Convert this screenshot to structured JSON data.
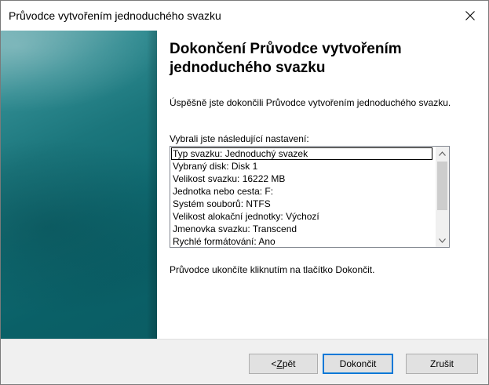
{
  "window": {
    "title": "Průvodce vytvořením jednoduchého svazku"
  },
  "content": {
    "heading": "Dokončení Průvodce vytvořením jednoduchého svazku",
    "success_text": "Úspěšně jste dokončili Průvodce vytvořením jednoduchého svazku.",
    "chosen_label": "Vybrali jste následující nastavení:",
    "settings": [
      "Typ svazku: Jednoduchý svazek",
      "Vybraný disk: Disk 1",
      "Velikost svazku: 16222 MB",
      "Jednotka nebo cesta: F:",
      "Systém souborů: NTFS",
      "Velikost alokační jednotky: Výchozí",
      "Jmenovka svazku: Transcend",
      "Rychlé formátování: Ano"
    ],
    "finish_hint": "Průvodce ukončíte kliknutím na tlačítko Dokončit."
  },
  "buttons": {
    "back_prefix": "< ",
    "back_accel": "Z",
    "back_rest": "pět",
    "finish": "Dokončit",
    "cancel": "Zrušit"
  },
  "icons": {
    "close": "close-icon",
    "scroll_up": "chevron-up-icon",
    "scroll_down": "chevron-down-icon"
  },
  "colors": {
    "banner": "#0f6a71",
    "default_button_border": "#0078d7"
  }
}
